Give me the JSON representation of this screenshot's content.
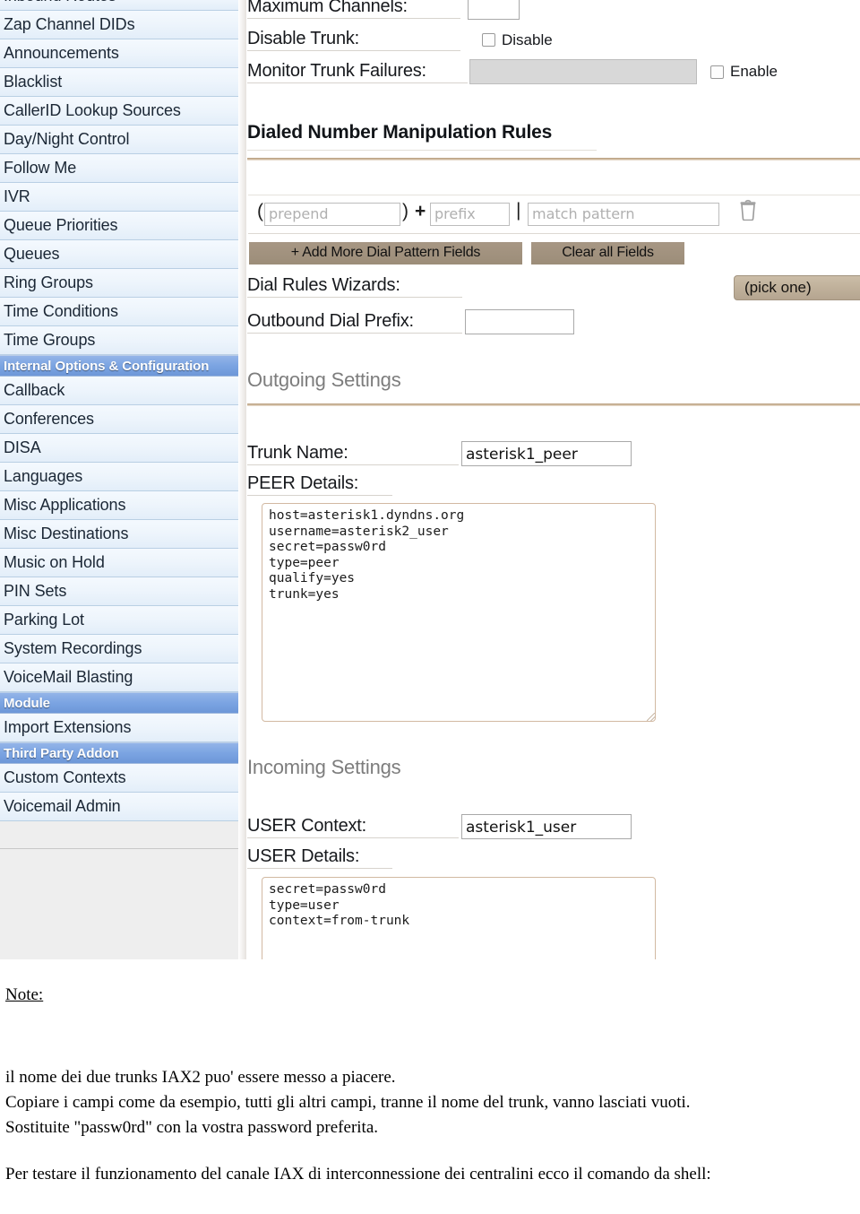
{
  "sidebar": {
    "items": [
      {
        "label": "Inbound Routes",
        "type": "item",
        "cut": true
      },
      {
        "label": "Zap Channel DIDs",
        "type": "item"
      },
      {
        "label": "Announcements",
        "type": "item"
      },
      {
        "label": "Blacklist",
        "type": "item"
      },
      {
        "label": "CallerID Lookup Sources",
        "type": "item"
      },
      {
        "label": "Day/Night Control",
        "type": "item"
      },
      {
        "label": "Follow Me",
        "type": "item"
      },
      {
        "label": "IVR",
        "type": "item"
      },
      {
        "label": "Queue Priorities",
        "type": "item"
      },
      {
        "label": "Queues",
        "type": "item"
      },
      {
        "label": "Ring Groups",
        "type": "item"
      },
      {
        "label": "Time Conditions",
        "type": "item"
      },
      {
        "label": "Time Groups",
        "type": "item"
      },
      {
        "label": "Internal Options & Configuration",
        "type": "header"
      },
      {
        "label": "Callback",
        "type": "item"
      },
      {
        "label": "Conferences",
        "type": "item"
      },
      {
        "label": "DISA",
        "type": "item"
      },
      {
        "label": "Languages",
        "type": "item"
      },
      {
        "label": "Misc Applications",
        "type": "item"
      },
      {
        "label": "Misc Destinations",
        "type": "item"
      },
      {
        "label": "Music on Hold",
        "type": "item"
      },
      {
        "label": "PIN Sets",
        "type": "item"
      },
      {
        "label": "Parking Lot",
        "type": "item"
      },
      {
        "label": "System Recordings",
        "type": "item"
      },
      {
        "label": "VoiceMail Blasting",
        "type": "item"
      },
      {
        "label": "Module",
        "type": "header"
      },
      {
        "label": "Import Extensions",
        "type": "item"
      },
      {
        "label": "Third Party Addon",
        "type": "header"
      },
      {
        "label": "Custom Contexts",
        "type": "item"
      },
      {
        "label": "Voicemail Admin",
        "type": "item"
      }
    ]
  },
  "main": {
    "max_channels": {
      "label": "Maximum Channels:",
      "value": ""
    },
    "disable_trunk": {
      "label": "Disable Trunk:",
      "checkbox_label": "Disable",
      "checked": false
    },
    "monitor_trunk_failures": {
      "label": "Monitor Trunk Failures:",
      "value": "",
      "checkbox_label": "Enable",
      "checked": false
    },
    "dialed_number_rules": {
      "title": "Dialed Number Manipulation Rules",
      "open_paren": "(",
      "close_paren": ")",
      "plus": "+",
      "pipe": "|",
      "prepend_placeholder": "prepend",
      "prefix_placeholder": "prefix",
      "match_placeholder": "match pattern",
      "trash_icon": "trash-icon",
      "add_more_label": "+ Add More Dial Pattern Fields",
      "clear_all_label": "Clear all Fields"
    },
    "dial_rules_wizards": {
      "label": "Dial Rules Wizards:",
      "selected": "(pick one)"
    },
    "outbound_dial_prefix": {
      "label": "Outbound Dial Prefix:",
      "value": ""
    },
    "outgoing_settings": {
      "title": "Outgoing Settings",
      "trunk_name_label": "Trunk Name:",
      "trunk_name_value": "asterisk1_peer",
      "peer_details_label": "PEER Details:",
      "peer_details_value": "host=asterisk1.dyndns.org\nusername=asterisk2_user\nsecret=passw0rd\ntype=peer\nqualify=yes\ntrunk=yes"
    },
    "incoming_settings": {
      "title": "Incoming Settings",
      "user_context_label": "USER Context:",
      "user_context_value": "asterisk1_user",
      "user_details_label": "USER Details:",
      "user_details_value": "secret=passw0rd\ntype=user\ncontext=from-trunk"
    }
  },
  "notes": {
    "heading": "Note:",
    "line1": "il nome dei due trunks IAX2 puo' essere messo a piacere.",
    "line2": "Copiare i campi come da esempio, tutti gli altri campi, tranne il nome del trunk, vanno lasciati vuoti.",
    "line3": "Sostituite \"passw0rd\" con la vostra password preferita.",
    "line4": "Per testare il funzionamento del canale IAX di interconnessione dei centralini ecco il comando da shell:"
  },
  "colors": {
    "nav_header_blue": "#7ba4e2",
    "nav_item_blue": "#eef5fc",
    "accent_tan": "#9c8d79",
    "rule_brown": "#b59b7c"
  }
}
